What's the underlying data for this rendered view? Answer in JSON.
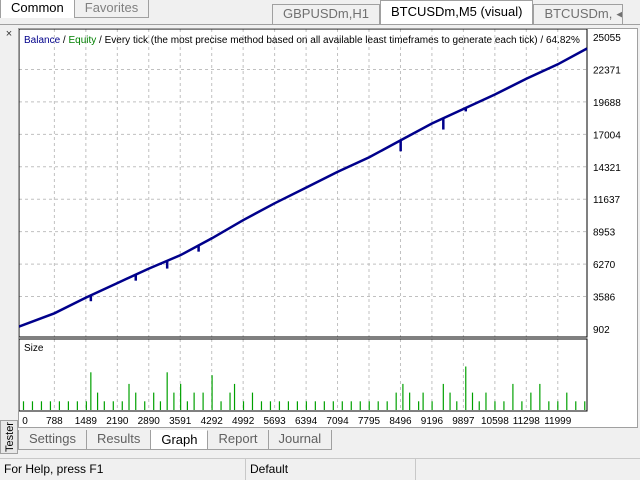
{
  "left_tabs": [
    {
      "label": "Common",
      "active": true
    },
    {
      "label": "Favorites",
      "active": false
    }
  ],
  "chart_tabs": [
    {
      "label": "GBPUSDm,H1",
      "active": false
    },
    {
      "label": "BTCUSDm,M5 (visual)",
      "active": true
    },
    {
      "label": "BTCUSDm,",
      "active": false
    }
  ],
  "side_panel": {
    "label": "Tester",
    "close": "×"
  },
  "bottom_tabs": [
    {
      "label": "Settings",
      "active": false
    },
    {
      "label": "Results",
      "active": false
    },
    {
      "label": "Graph",
      "active": true
    },
    {
      "label": "Report",
      "active": false
    },
    {
      "label": "Journal",
      "active": false
    }
  ],
  "status": {
    "help": "For Help, press F1",
    "profile": "Default"
  },
  "legend": {
    "balance": "Balance",
    "sep1": " / ",
    "equity": "Equity",
    "sep2": " / ",
    "description": "Every tick (the most precise method based on all available least timeframes to generate each tick)",
    "sep3": " / ",
    "percent": "64.82%"
  },
  "colors": {
    "balance": "#00008b",
    "equity": "#008000",
    "size_bars": "#00a000",
    "grid": "#c0c0c0"
  },
  "chart_data": {
    "type": "line",
    "main": {
      "series": [
        {
          "name": "Balance",
          "color": "#00008b"
        }
      ],
      "ylim": [
        902,
        25055
      ],
      "y_ticks": [
        "25055",
        "22371",
        "19688",
        "17004",
        "14321",
        "11637",
        "8953",
        "6270",
        "3586",
        "902"
      ],
      "x_ticks": [
        "0",
        "788",
        "1489",
        "2190",
        "2890",
        "3591",
        "4292",
        "4992",
        "5693",
        "6394",
        "7094",
        "7795",
        "8496",
        "9196",
        "9897",
        "10598",
        "11298",
        "11999"
      ],
      "xlim": [
        0,
        12650
      ],
      "balance_points": [
        [
          0,
          1100
        ],
        [
          788,
          2200
        ],
        [
          1489,
          3500
        ],
        [
          2190,
          4700
        ],
        [
          2890,
          5900
        ],
        [
          3591,
          7000
        ],
        [
          4292,
          8400
        ],
        [
          4992,
          9900
        ],
        [
          5693,
          11300
        ],
        [
          6394,
          12600
        ],
        [
          7094,
          13900
        ],
        [
          7795,
          15100
        ],
        [
          8496,
          16500
        ],
        [
          9196,
          17900
        ],
        [
          9897,
          19100
        ],
        [
          10598,
          20300
        ],
        [
          11298,
          21600
        ],
        [
          11999,
          22800
        ],
        [
          12650,
          24100
        ]
      ],
      "equity_dips": [
        [
          1600,
          3200
        ],
        [
          2600,
          4900
        ],
        [
          3150,
          6200
        ],
        [
          3300,
          5900
        ],
        [
          4000,
          7300
        ],
        [
          4300,
          8500
        ],
        [
          8500,
          15600
        ],
        [
          9450,
          17400
        ],
        [
          9950,
          18900
        ]
      ]
    },
    "size": {
      "label": "Size",
      "bars": [
        [
          100,
          0.15
        ],
        [
          300,
          0.15
        ],
        [
          500,
          0.15
        ],
        [
          700,
          0.15
        ],
        [
          900,
          0.15
        ],
        [
          1100,
          0.15
        ],
        [
          1300,
          0.15
        ],
        [
          1500,
          0.15
        ],
        [
          1600,
          0.65
        ],
        [
          1750,
          0.3
        ],
        [
          1900,
          0.15
        ],
        [
          2100,
          0.15
        ],
        [
          2300,
          0.15
        ],
        [
          2450,
          0.45
        ],
        [
          2600,
          0.3
        ],
        [
          2800,
          0.15
        ],
        [
          3000,
          0.3
        ],
        [
          3150,
          0.15
        ],
        [
          3300,
          0.65
        ],
        [
          3450,
          0.3
        ],
        [
          3600,
          0.45
        ],
        [
          3750,
          0.15
        ],
        [
          3900,
          0.3
        ],
        [
          4100,
          0.3
        ],
        [
          4300,
          0.6
        ],
        [
          4500,
          0.15
        ],
        [
          4700,
          0.3
        ],
        [
          4800,
          0.45
        ],
        [
          5000,
          0.15
        ],
        [
          5200,
          0.3
        ],
        [
          5400,
          0.15
        ],
        [
          5600,
          0.15
        ],
        [
          5800,
          0.15
        ],
        [
          6000,
          0.15
        ],
        [
          6200,
          0.15
        ],
        [
          6400,
          0.15
        ],
        [
          6600,
          0.15
        ],
        [
          6800,
          0.15
        ],
        [
          7000,
          0.15
        ],
        [
          7200,
          0.15
        ],
        [
          7400,
          0.15
        ],
        [
          7600,
          0.15
        ],
        [
          7800,
          0.15
        ],
        [
          8000,
          0.15
        ],
        [
          8200,
          0.15
        ],
        [
          8400,
          0.3
        ],
        [
          8550,
          0.45
        ],
        [
          8700,
          0.3
        ],
        [
          8900,
          0.15
        ],
        [
          9000,
          0.3
        ],
        [
          9200,
          0.15
        ],
        [
          9450,
          0.45
        ],
        [
          9600,
          0.3
        ],
        [
          9750,
          0.15
        ],
        [
          9950,
          0.75
        ],
        [
          10100,
          0.3
        ],
        [
          10250,
          0.15
        ],
        [
          10400,
          0.3
        ],
        [
          10600,
          0.15
        ],
        [
          10800,
          0.15
        ],
        [
          11000,
          0.45
        ],
        [
          11200,
          0.15
        ],
        [
          11400,
          0.3
        ],
        [
          11600,
          0.45
        ],
        [
          11800,
          0.15
        ],
        [
          12000,
          0.15
        ],
        [
          12200,
          0.3
        ],
        [
          12400,
          0.15
        ],
        [
          12600,
          0.15
        ]
      ]
    }
  }
}
